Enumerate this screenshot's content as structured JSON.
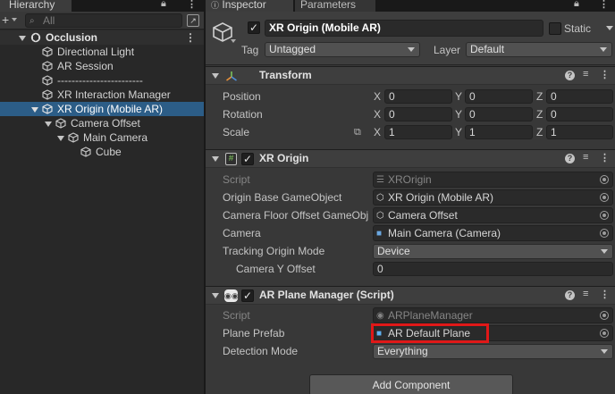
{
  "hierarchy": {
    "tab_label": "Hierarchy",
    "search_placeholder": "All",
    "scene_name": "Occlusion",
    "items": [
      {
        "label": "Directional Light"
      },
      {
        "label": "AR Session"
      },
      {
        "label": "------------------------"
      },
      {
        "label": "XR Interaction Manager"
      },
      {
        "label": "XR Origin (Mobile AR)"
      },
      {
        "label": "Camera Offset"
      },
      {
        "label": "Main Camera"
      },
      {
        "label": "Cube"
      }
    ]
  },
  "inspector": {
    "tabs": [
      {
        "label": "Inspector"
      },
      {
        "label": "Parameters"
      }
    ],
    "object_name": "XR Origin (Mobile AR)",
    "static_label": "Static",
    "tag_label": "Tag",
    "tag_value": "Untagged",
    "layer_label": "Layer",
    "layer_value": "Default",
    "transform": {
      "title": "Transform",
      "axes": [
        "X",
        "Y",
        "Z"
      ],
      "rows": [
        {
          "label": "Position",
          "x": "0",
          "y": "0",
          "z": "0"
        },
        {
          "label": "Rotation",
          "x": "0",
          "y": "0",
          "z": "0"
        },
        {
          "label": "Scale",
          "x": "1",
          "y": "1",
          "z": "1"
        }
      ]
    },
    "xr_origin": {
      "title": "XR Origin",
      "script_label": "Script",
      "script_value": "XROrigin",
      "base_label": "Origin Base GameObject",
      "base_value": "XR Origin (Mobile AR)",
      "floor_label": "Camera Floor Offset GameObj",
      "floor_value": "Camera Offset",
      "camera_label": "Camera",
      "camera_value": "Main Camera (Camera)",
      "tracking_label": "Tracking Origin Mode",
      "tracking_value": "Device",
      "yoffset_label": "Camera Y Offset",
      "yoffset_value": "0"
    },
    "plane_manager": {
      "title": "AR Plane Manager (Script)",
      "script_label": "Script",
      "script_value": "ARPlaneManager",
      "prefab_label": "Plane Prefab",
      "prefab_value": "AR Default Plane",
      "detection_label": "Detection Mode",
      "detection_value": "Everything"
    },
    "add_component_label": "Add Component"
  },
  "colors": {
    "selection": "#2c5d87",
    "highlight_box": "#e01818",
    "background": "#383838"
  }
}
